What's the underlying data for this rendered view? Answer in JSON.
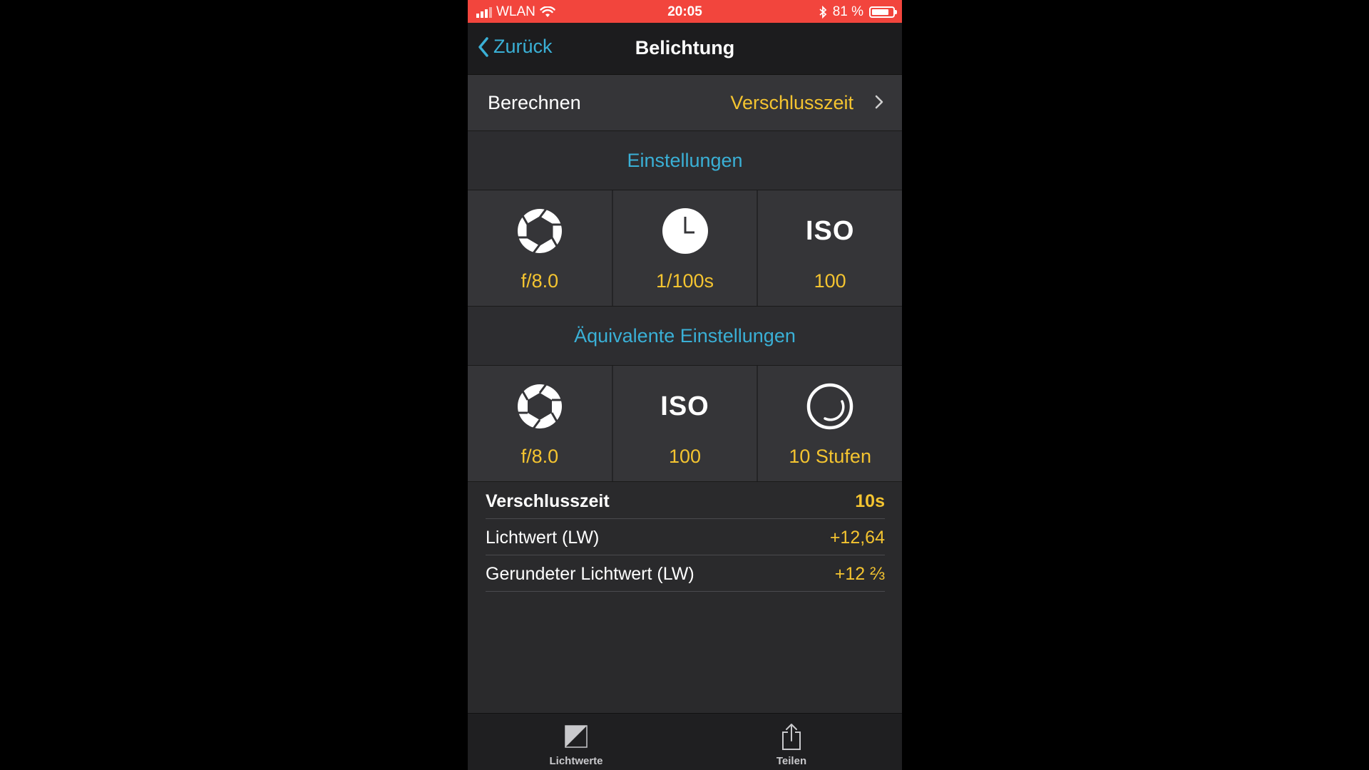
{
  "status_bar": {
    "carrier": "WLAN",
    "time": "20:05",
    "battery": "81 %",
    "battery_level": 0.81,
    "icons": [
      "signal-bars-icon",
      "wifi-icon",
      "bluetooth-icon",
      "battery-icon"
    ]
  },
  "nav": {
    "back_label": "Zurück",
    "title": "Belichtung"
  },
  "calc": {
    "label": "Berechnen",
    "value": "Verschlusszeit"
  },
  "sections": {
    "settings_header": "Einstellungen",
    "equivalent_header": "Äquivalente Einstellungen"
  },
  "settings": [
    {
      "icon": "aperture-icon",
      "value": "f/8.0"
    },
    {
      "icon": "clock-icon",
      "value": "1/100s"
    },
    {
      "icon": "iso-icon",
      "icon_text": "ISO",
      "value": "100"
    }
  ],
  "equivalent": [
    {
      "icon": "aperture-icon",
      "value": "f/8.0"
    },
    {
      "icon": "iso-icon",
      "icon_text": "ISO",
      "value": "100"
    },
    {
      "icon": "nd-filter-icon",
      "value": "10 Stufen"
    }
  ],
  "results": [
    {
      "label": "Verschlusszeit",
      "value": "10s"
    },
    {
      "label": "Lichtwert (LW)",
      "value": "+12,64"
    },
    {
      "label": "Gerundeter Lichtwert (LW)",
      "value": "+12 ⅔"
    }
  ],
  "tabs": [
    {
      "label": "Lichtwerte",
      "icon": "exposure-value-icon"
    },
    {
      "label": "Teilen",
      "icon": "share-icon"
    }
  ],
  "colors": {
    "accent_blue": "#3ab0d6",
    "value_yellow": "#f4c430",
    "status_bar_red": "#f2453d"
  }
}
